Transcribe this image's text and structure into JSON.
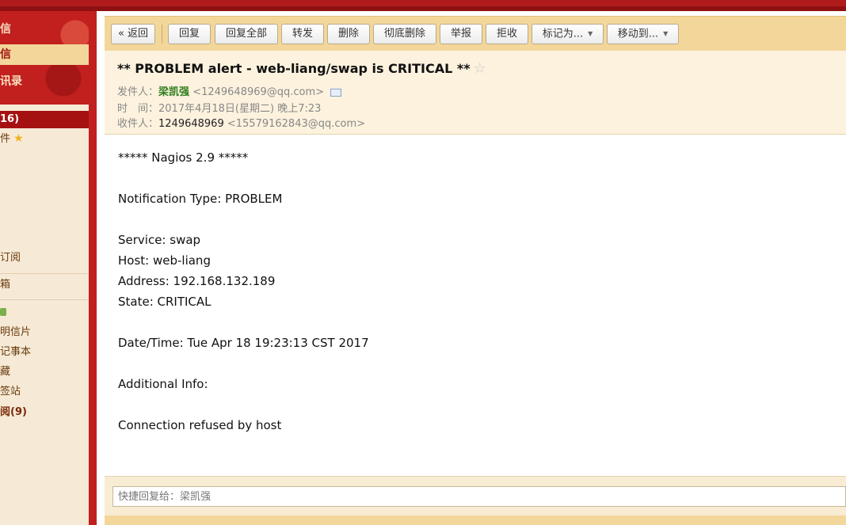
{
  "sidebar": {
    "top_items": [
      "信",
      "信",
      "讯录"
    ],
    "inbox_label": "16)",
    "star_item": "件",
    "items": [
      "订阅",
      "箱",
      "",
      "明信片",
      "记事本",
      "藏",
      "签站",
      "阅(9)"
    ]
  },
  "toolbar": {
    "back": "« 返回",
    "reply": "回复",
    "reply_all": "回复全部",
    "forward": "转发",
    "delete": "删除",
    "delete_permanent": "彻底删除",
    "report": "举报",
    "reject": "拒收",
    "mark_as": "标记为...",
    "move_to": "移动到..."
  },
  "mail": {
    "subject": "** PROBLEM alert - web-liang/swap is CRITICAL **",
    "from_label": "发件人：",
    "from_name": "梁凯强",
    "from_email": "<1249648969@qq.com>",
    "time_label": "时　间：",
    "time_value": "2017年4月18日(星期二) 晚上7:23",
    "to_label": "收件人：",
    "to_name": "1249648969",
    "to_email": "<15579162843@qq.com>"
  },
  "body": {
    "line1": "***** Nagios 2.9 *****",
    "line2": "Notification Type: PROBLEM",
    "line3": "Service: swap",
    "line4": "Host: web-liang",
    "line5": "Address: 192.168.132.189",
    "line6": "State: CRITICAL",
    "line7": "Date/Time: Tue Apr 18 19:23:13 CST 2017",
    "line8": "Additional Info:",
    "line9": "Connection refused by host"
  },
  "quick_reply": {
    "placeholder": "快捷回复给：梁凯强"
  },
  "colors": {
    "theme_red": "#c21f1f",
    "toolbar_bg": "#f3d79a",
    "sender_green": "#2f7d1e"
  }
}
